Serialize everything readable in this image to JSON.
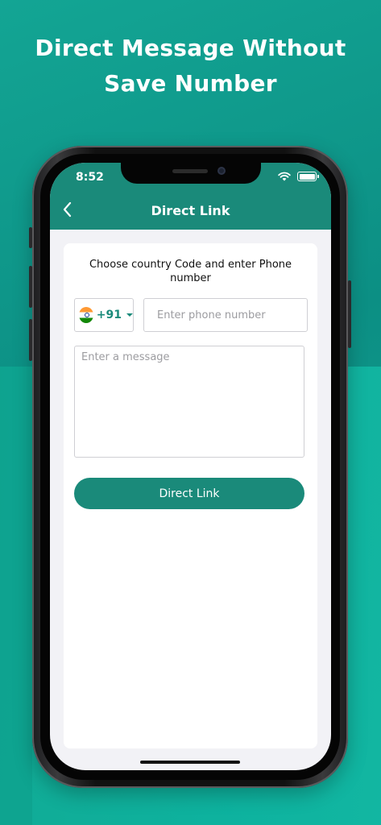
{
  "promo": {
    "headline_line1": "Direct Message Without",
    "headline_line2": "Save Number"
  },
  "status_bar": {
    "time": "8:52",
    "icons": [
      "wifi-icon",
      "battery-icon"
    ]
  },
  "nav": {
    "back_icon": "chevron-left-icon",
    "title": "Direct Link"
  },
  "form": {
    "instruction": "Choose country Code and enter Phone number",
    "country": {
      "flag_icon": "india-flag-icon",
      "code": "+91",
      "dropdown_icon": "caret-down-icon"
    },
    "phone_placeholder": "Enter phone number",
    "phone_value": "",
    "message_placeholder": "Enter a message",
    "message_value": "",
    "submit_label": "Direct Link"
  },
  "colors": {
    "accent": "#1a8a7a",
    "background": "#0f9b8e",
    "screen_bg": "#f2f2f6"
  }
}
